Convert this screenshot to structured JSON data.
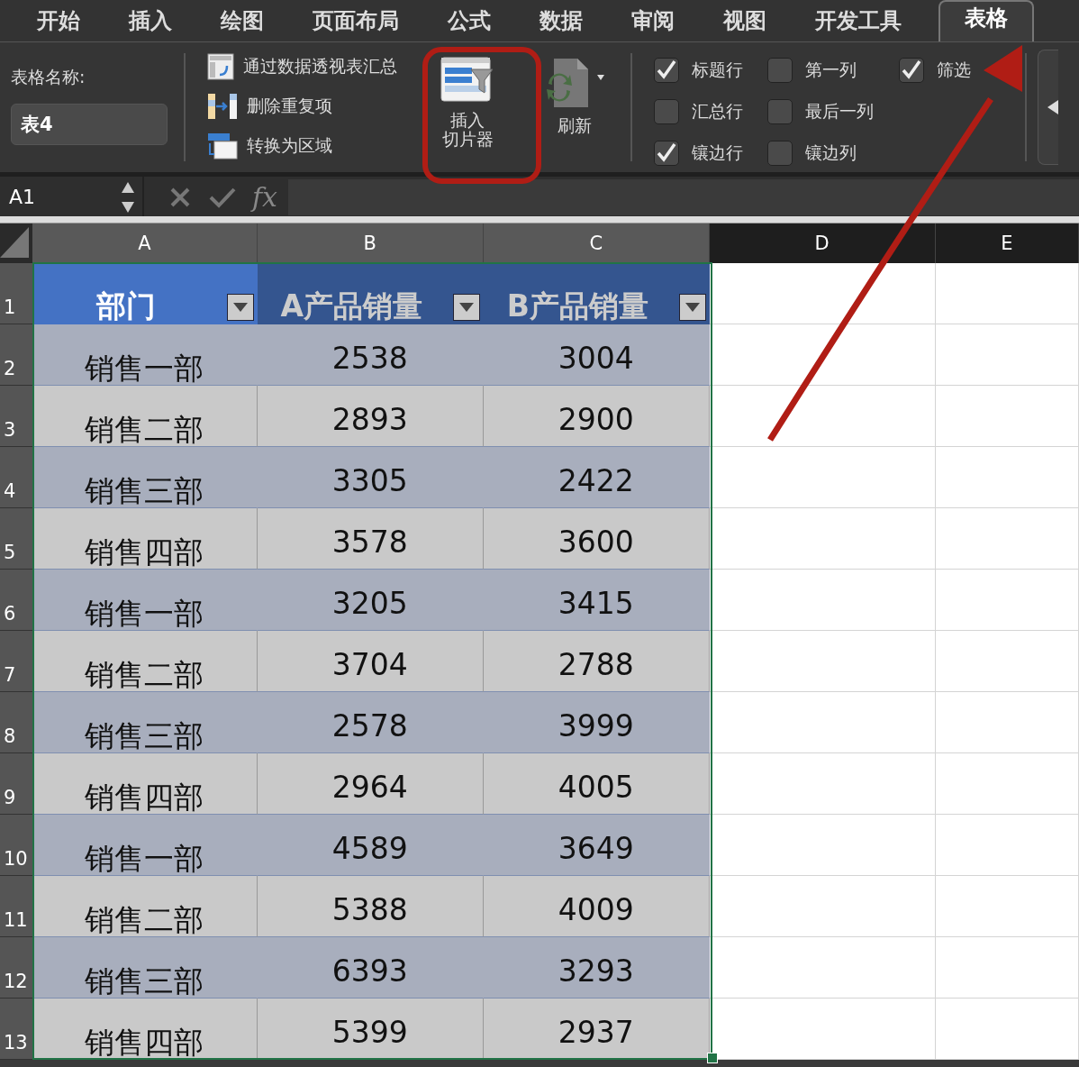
{
  "menu_tabs": [
    {
      "label": "开始",
      "selected": false
    },
    {
      "label": "插入",
      "selected": false
    },
    {
      "label": "绘图",
      "selected": false
    },
    {
      "label": "页面布局",
      "selected": false
    },
    {
      "label": "公式",
      "selected": false
    },
    {
      "label": "数据",
      "selected": false
    },
    {
      "label": "审阅",
      "selected": false
    },
    {
      "label": "视图",
      "selected": false
    },
    {
      "label": "开发工具",
      "selected": false
    },
    {
      "label": "表格",
      "selected": true
    }
  ],
  "ribbon": {
    "table_name_label": "表格名称:",
    "table_name": "表4",
    "tools": [
      {
        "kind": "pivot",
        "label": "通过数据透视表汇总"
      },
      {
        "kind": "dedupe",
        "label": "删除重复项"
      },
      {
        "kind": "convert",
        "label": "转换为区域"
      }
    ],
    "slicer_button": [
      "插入",
      "切片器"
    ],
    "refresh_button": "刷新",
    "options": [
      {
        "label": "标题行",
        "checked": true
      },
      {
        "label": "汇总行",
        "checked": false
      },
      {
        "label": "镶边行",
        "checked": true
      },
      {
        "label": "第一列",
        "checked": false
      },
      {
        "label": "最后一列",
        "checked": false
      },
      {
        "label": "镶边列",
        "checked": false
      },
      {
        "label": "筛选",
        "checked": true
      }
    ]
  },
  "formula_bar": {
    "name_box": "A1",
    "fx": "fx"
  },
  "columns": [
    {
      "label": "A",
      "selected": true
    },
    {
      "label": "B",
      "selected": true
    },
    {
      "label": "C",
      "selected": true
    },
    {
      "label": "D",
      "selected": false
    },
    {
      "label": "E",
      "selected": false
    }
  ],
  "row_headers": [
    "1",
    "2",
    "3",
    "4",
    "5",
    "6",
    "7",
    "8",
    "9",
    "10",
    "11",
    "12",
    "13"
  ],
  "header_row": [
    {
      "text": "部门",
      "selected": true
    },
    {
      "text": "A产品销量",
      "selected": false
    },
    {
      "text": "B产品销量",
      "selected": false
    }
  ],
  "rows": [
    [
      "销售一部",
      "2538",
      "3004"
    ],
    [
      "销售二部",
      "2893",
      "2900"
    ],
    [
      "销售三部",
      "3305",
      "2422"
    ],
    [
      "销售四部",
      "3578",
      "3600"
    ],
    [
      "销售一部",
      "3205",
      "3415"
    ],
    [
      "销售二部",
      "3704",
      "2788"
    ],
    [
      "销售三部",
      "2578",
      "3999"
    ],
    [
      "销售四部",
      "2964",
      "4005"
    ],
    [
      "销售一部",
      "4589",
      "3649"
    ],
    [
      "销售二部",
      "5388",
      "4009"
    ],
    [
      "销售三部",
      "6393",
      "3293"
    ],
    [
      "销售四部",
      "5399",
      "2937"
    ]
  ]
}
